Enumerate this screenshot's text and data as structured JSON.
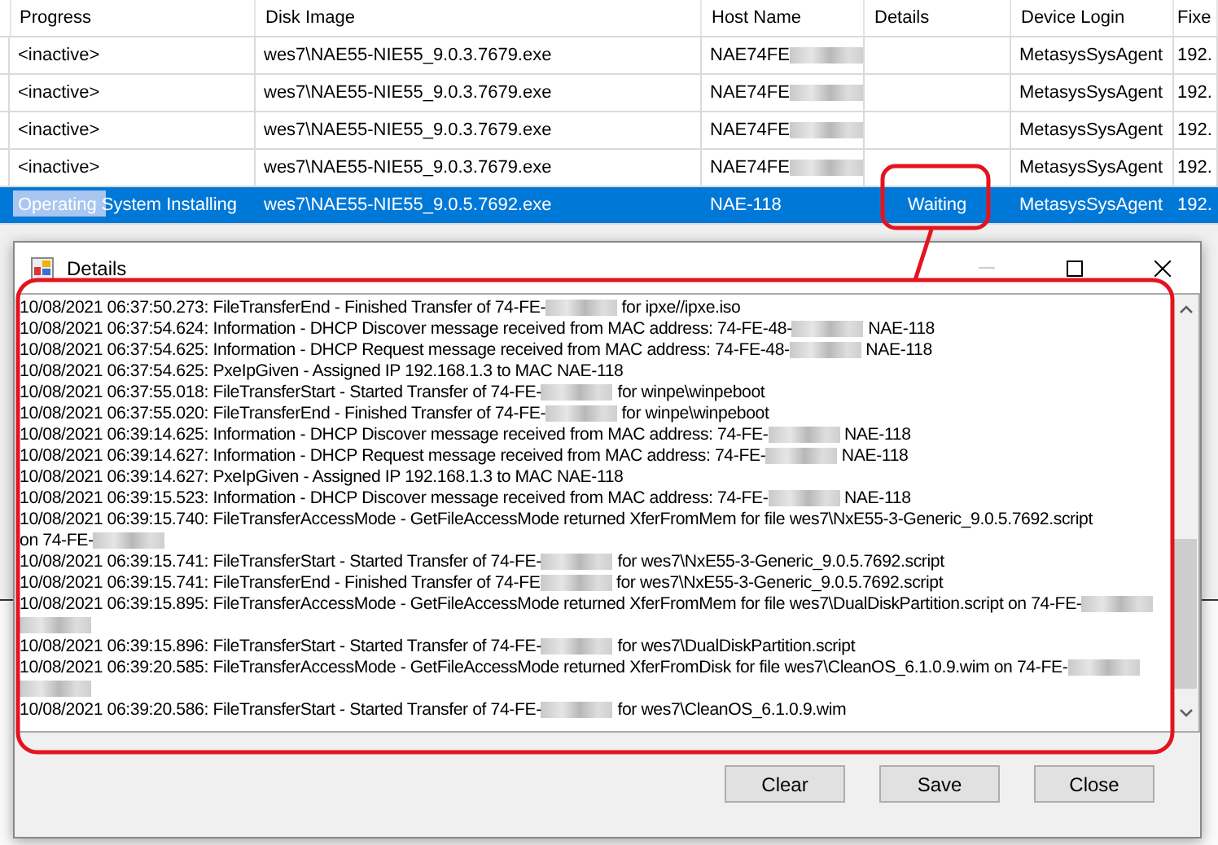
{
  "table": {
    "columns": [
      "Progress",
      "Disk Image",
      "Host Name",
      "Details",
      "Device Login",
      "Fixe"
    ],
    "rows": [
      {
        "selected": false,
        "progress": "<inactive>",
        "disk_image": "wes7\\NAE55-NIE55_9.0.3.7679.exe",
        "host_name": "NAE74FE",
        "host_redacted": true,
        "device_login": "MetasysSysAgent",
        "fixed": "192."
      },
      {
        "selected": false,
        "progress": "<inactive>",
        "disk_image": "wes7\\NAE55-NIE55_9.0.3.7679.exe",
        "host_name": "NAE74FE",
        "host_redacted": true,
        "device_login": "MetasysSysAgent",
        "fixed": "192."
      },
      {
        "selected": false,
        "progress": "<inactive>",
        "disk_image": "wes7\\NAE55-NIE55_9.0.3.7679.exe",
        "host_name": "NAE74FE",
        "host_redacted": true,
        "device_login": "MetasysSysAgent",
        "fixed": "192."
      },
      {
        "selected": false,
        "progress": "<inactive>",
        "disk_image": "wes7\\NAE55-NIE55_9.0.3.7679.exe",
        "host_name": "NAE74FE",
        "host_redacted": true,
        "device_login": "MetasysSysAgent",
        "fixed": "192."
      },
      {
        "selected": true,
        "progress": "Operating System Installing",
        "level": 0.38,
        "disk_image": "wes7\\NAE55-NIE55_9.0.5.7692.exe",
        "host_name": "NAE-118",
        "host_redacted": false,
        "details": "Waiting",
        "device_login": "MetasysSysAgent",
        "fixed": "192."
      }
    ]
  },
  "dialog": {
    "title": "Details",
    "log_lines": [
      [
        {
          "kind": "text",
          "text": "10/08/2021 06:37:50.273: FileTransferEnd - Finished Transfer of 74-FE-"
        },
        {
          "kind": "redacted"
        },
        {
          "kind": "text",
          "text": " for ipxe//ipxe.iso"
        }
      ],
      [
        {
          "kind": "text",
          "text": "10/08/2021 06:37:54.624: Information - DHCP Discover message received from MAC address: 74-FE-48-"
        },
        {
          "kind": "redacted"
        },
        {
          "kind": "text",
          "text": " NAE-118"
        }
      ],
      [
        {
          "kind": "text",
          "text": "10/08/2021 06:37:54.625: Information - DHCP Request message received from MAC address: 74-FE-48-"
        },
        {
          "kind": "redacted"
        },
        {
          "kind": "text",
          "text": " NAE-118"
        }
      ],
      [
        {
          "kind": "text",
          "text": "10/08/2021 06:37:54.625: PxeIpGiven - Assigned IP 192.168.1.3 to MAC NAE-118"
        }
      ],
      [
        {
          "kind": "text",
          "text": "10/08/2021 06:37:55.018: FileTransferStart - Started Transfer of 74-FE-"
        },
        {
          "kind": "redacted"
        },
        {
          "kind": "text",
          "text": " for winpe\\winpeboot"
        }
      ],
      [
        {
          "kind": "text",
          "text": "10/08/2021 06:37:55.020: FileTransferEnd - Finished Transfer of 74-FE-"
        },
        {
          "kind": "redacted"
        },
        {
          "kind": "text",
          "text": " for winpe\\winpeboot"
        }
      ],
      [
        {
          "kind": "text",
          "text": "10/08/2021 06:39:14.625: Information - DHCP Discover message received from MAC address: 74-FE-"
        },
        {
          "kind": "redacted"
        },
        {
          "kind": "text",
          "text": " NAE-118"
        }
      ],
      [
        {
          "kind": "text",
          "text": "10/08/2021 06:39:14.627: Information - DHCP Request message received from MAC address: 74-FE-"
        },
        {
          "kind": "redacted"
        },
        {
          "kind": "text",
          "text": " NAE-118"
        }
      ],
      [
        {
          "kind": "text",
          "text": "10/08/2021 06:39:14.627: PxeIpGiven - Assigned IP 192.168.1.3 to MAC NAE-118"
        }
      ],
      [
        {
          "kind": "text",
          "text": "10/08/2021 06:39:15.523: Information - DHCP Discover message received from MAC address: 74-FE-"
        },
        {
          "kind": "redacted"
        },
        {
          "kind": "text",
          "text": " NAE-118"
        }
      ],
      [
        {
          "kind": "text",
          "text": "10/08/2021 06:39:15.740: FileTransferAccessMode - GetFileAccessMode returned XferFromMem for file wes7\\NxE55-3-Generic_9.0.5.7692.script"
        }
      ],
      [
        {
          "kind": "text",
          "text": "on 74-FE-"
        },
        {
          "kind": "redacted"
        }
      ],
      [
        {
          "kind": "text",
          "text": "10/08/2021 06:39:15.741: FileTransferStart - Started Transfer of 74-FE-"
        },
        {
          "kind": "redacted"
        },
        {
          "kind": "text",
          "text": " for wes7\\NxE55-3-Generic_9.0.5.7692.script"
        }
      ],
      [
        {
          "kind": "text",
          "text": "10/08/2021 06:39:15.741: FileTransferEnd - Finished Transfer of 74-FE"
        },
        {
          "kind": "redacted"
        },
        {
          "kind": "text",
          "text": " for wes7\\NxE55-3-Generic_9.0.5.7692.script"
        }
      ],
      [
        {
          "kind": "text",
          "text": "10/08/2021 06:39:15.895: FileTransferAccessMode - GetFileAccessMode returned XferFromMem for file wes7\\DualDiskPartition.script on 74-FE-"
        },
        {
          "kind": "redacted"
        }
      ],
      [
        {
          "kind": "redacted"
        }
      ],
      [
        {
          "kind": "text",
          "text": "10/08/2021 06:39:15.896: FileTransferStart - Started Transfer of 74-FE-"
        },
        {
          "kind": "redacted"
        },
        {
          "kind": "text",
          "text": " for wes7\\DualDiskPartition.script"
        }
      ],
      [
        {
          "kind": "text",
          "text": "10/08/2021 06:39:20.585: FileTransferAccessMode - GetFileAccessMode returned XferFromDisk for file wes7\\CleanOS_6.1.0.9.wim on 74-FE-"
        },
        {
          "kind": "redacted"
        }
      ],
      [
        {
          "kind": "redacted"
        }
      ],
      [
        {
          "kind": "text",
          "text": "10/08/2021 06:39:20.586: FileTransferStart - Started Transfer of 74-FE-"
        },
        {
          "kind": "redacted"
        },
        {
          "kind": "text",
          "text": " for wes7\\CleanOS_6.1.0.9.wim"
        }
      ]
    ],
    "buttons": [
      "Clear",
      "Save",
      "Close"
    ]
  }
}
